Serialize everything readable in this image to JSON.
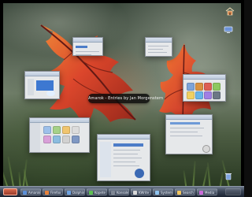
{
  "overlay": {
    "caption": "Amarok - Entries by Jan Morgenstern"
  },
  "taskbar": {
    "items": [
      {
        "label": "Amarok",
        "icon": "music-icon",
        "color": "#5b8fd8"
      },
      {
        "label": "Firefox",
        "icon": "browser-icon",
        "color": "#e6813b"
      },
      {
        "label": "Dolphin",
        "icon": "folder-icon",
        "color": "#6da2e0"
      },
      {
        "label": "Kopete",
        "icon": "chat-icon",
        "color": "#5dbf52"
      },
      {
        "label": "Konsole",
        "icon": "terminal-icon",
        "color": "#7f8794"
      },
      {
        "label": "KWrite",
        "icon": "document-icon",
        "color": "#d8d8d8"
      },
      {
        "label": "System",
        "icon": "gear-icon",
        "color": "#8ec3ef"
      },
      {
        "label": "Search",
        "icon": "search-icon",
        "color": "#f1c55e"
      },
      {
        "label": "Media",
        "icon": "media-icon",
        "color": "#ca6bd9"
      }
    ]
  },
  "corner_icons": {
    "top_right": "house-icon",
    "right_middle": "network-icon",
    "bottom_right": "trash-icon"
  },
  "colors": {
    "leaf_red": "#d9472d",
    "leaf_orange": "#e86f2f",
    "leaf_dark": "#8f2419",
    "selection_blue": "#4d7dc8"
  }
}
